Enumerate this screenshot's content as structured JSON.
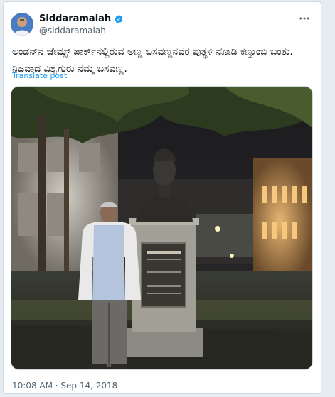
{
  "tweet": {
    "author_name": "Siddaramaiah",
    "handle": "@siddaramaiah",
    "text": "ಲಂಡನ್‌ನ ಜೇಮ್ಸ್ ಪಾರ್ಕ್‌ನಲ್ಲಿರುವ ಅಣ್ಣ ಬಸವಣ್ಣನವರ ಪುತ್ಥಳಿ ನೋಡಿ ಕಣ್ತುಂಬಿ ಬಂತು. ನಿಜವಾದ ವಿಶ್ವಗುರು ನಮ್ಮ ಬಸವಣ್ಣ.",
    "translate_label": "Translate post",
    "timestamp": "10:08 AM · Sep 14, 2018"
  },
  "icons": {
    "verified": "verified-badge-icon",
    "more": "more-options-icon"
  },
  "colors": {
    "link": "#1d9bf0",
    "secondary_text": "#536471",
    "border": "#cfd9de",
    "verified": "#1d9bf0"
  }
}
